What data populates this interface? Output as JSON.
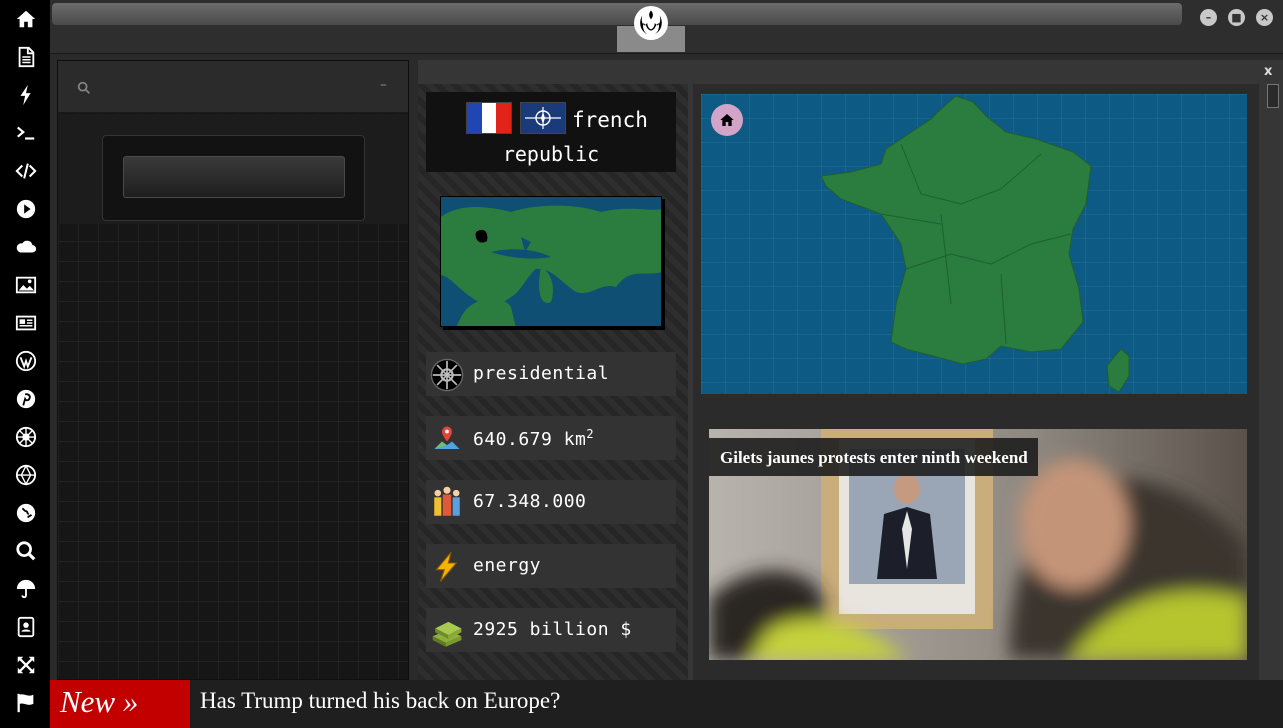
{
  "rail": {
    "icons": [
      "home-icon",
      "document-icon",
      "bolt-icon",
      "terminal-icon",
      "code-icon",
      "play-icon",
      "cloud-icon",
      "image-icon",
      "newspaper-icon",
      "wordpress-icon",
      "pinterest-icon",
      "empire-icon",
      "galactic-republic-icon",
      "globe-icon",
      "search-icon",
      "umbrella-icon",
      "contacts-icon",
      "expand-icon",
      "flag-icon"
    ]
  },
  "window": {
    "minimize": "–",
    "maximize": "■",
    "close": "×"
  },
  "left_panel": {
    "minimize_label": "–"
  },
  "main": {
    "close_label": "x"
  },
  "country": {
    "title_line1": "french",
    "title_line2": "republic",
    "flag_colors": [
      "#1f46b3",
      "#ffffff",
      "#e2231a"
    ]
  },
  "stats": {
    "government": "presidential",
    "area": "640.679 km",
    "area_unit_sup": "2",
    "population": "67.348.000",
    "industry": "energy",
    "gdp": "2925 billion $"
  },
  "news": {
    "headline": "Gilets jaunes protests enter ninth weekend"
  },
  "ticker": {
    "tag": "New »",
    "text": "Has Trump turned his back on Europe?"
  },
  "colors": {
    "sea": "#0d5a84",
    "land": "#2b7d3f",
    "ticker_tag": "#c20000",
    "home_button": "#d4a3c8"
  }
}
